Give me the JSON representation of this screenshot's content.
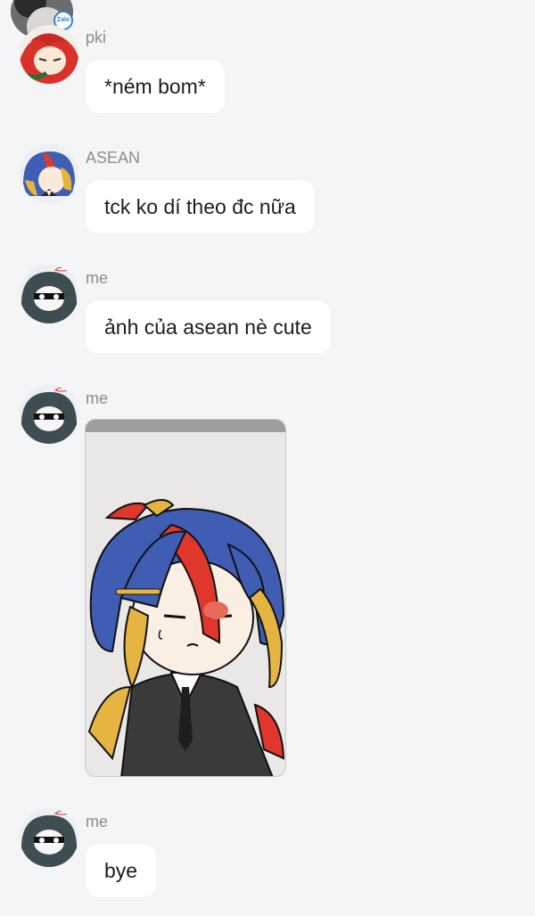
{
  "app": {
    "badge_label": "Zalo",
    "watermark_text": ""
  },
  "messages": [
    {
      "sender": "pki",
      "text": "*ném bom*",
      "avatar_icon": "red-hair-avatar-icon"
    },
    {
      "sender": "ASEAN",
      "text": "tck ko dí theo đc nữa",
      "avatar_icon": "asean-avatar-icon"
    },
    {
      "sender": "me",
      "text": "ảnh của asean nè cute",
      "avatar_icon": "dark-hair-avatar-icon"
    },
    {
      "sender": "me",
      "image": "drawn-character-image",
      "avatar_icon": "dark-hair-avatar-icon"
    },
    {
      "sender": "me",
      "text": "bye",
      "avatar_icon": "dark-hair-avatar-icon"
    }
  ],
  "colors": {
    "background": "#f4f5f7",
    "bubble": "#ffffff",
    "sender_text": "#8a8d91",
    "message_text": "#1c1d1f"
  }
}
